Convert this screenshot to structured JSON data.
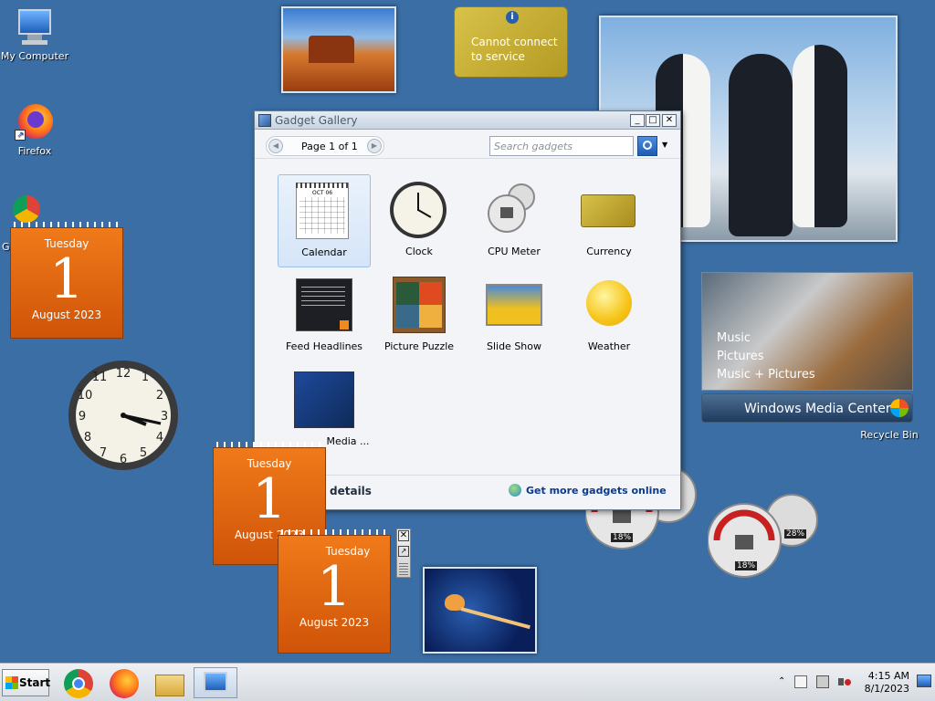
{
  "desktop_icons": {
    "my_computer": "My Computer",
    "firefox": "Firefox",
    "chrome": "Go",
    "recycle_bin": "Recycle Bin"
  },
  "calendars": [
    {
      "dow": "Tuesday",
      "day": "1",
      "month": "August 2023"
    },
    {
      "dow": "Tuesday",
      "day": "1",
      "month": "August 2023"
    },
    {
      "dow": "Tuesday",
      "day": "1",
      "month": "August 2023"
    }
  ],
  "currency_gadget": {
    "text": "Cannot connect to service"
  },
  "gallery": {
    "title": "Gadget Gallery",
    "pager_text": "Page 1 of 1",
    "search_placeholder": "Search gadgets",
    "items": [
      {
        "label": "Calendar"
      },
      {
        "label": "Clock"
      },
      {
        "label": "CPU Meter"
      },
      {
        "label": "Currency"
      },
      {
        "label": "Feed Headlines"
      },
      {
        "label": "Picture Puzzle"
      },
      {
        "label": "Slide Show"
      },
      {
        "label": "Weather"
      },
      {
        "label": "Media ..."
      }
    ],
    "calendar_thumb_month": "OCT 06",
    "show_details": "details",
    "get_more": "Get more gadgets online"
  },
  "media_center": {
    "menu": [
      "Music",
      "Pictures",
      "Music + Pictures"
    ],
    "logo_a": "Windows",
    "logo_b": " Media Center"
  },
  "cpu_meters": [
    {
      "value": "18%"
    },
    {
      "value": "18%"
    },
    {
      "value": "28%"
    }
  ],
  "taskbar": {
    "start": "Start",
    "time": "4:15 AM",
    "date": "8/1/2023"
  },
  "colors": {
    "desktop": "#3a6ea5",
    "calendar": "#e8661a",
    "accent": "#1c5db5"
  }
}
